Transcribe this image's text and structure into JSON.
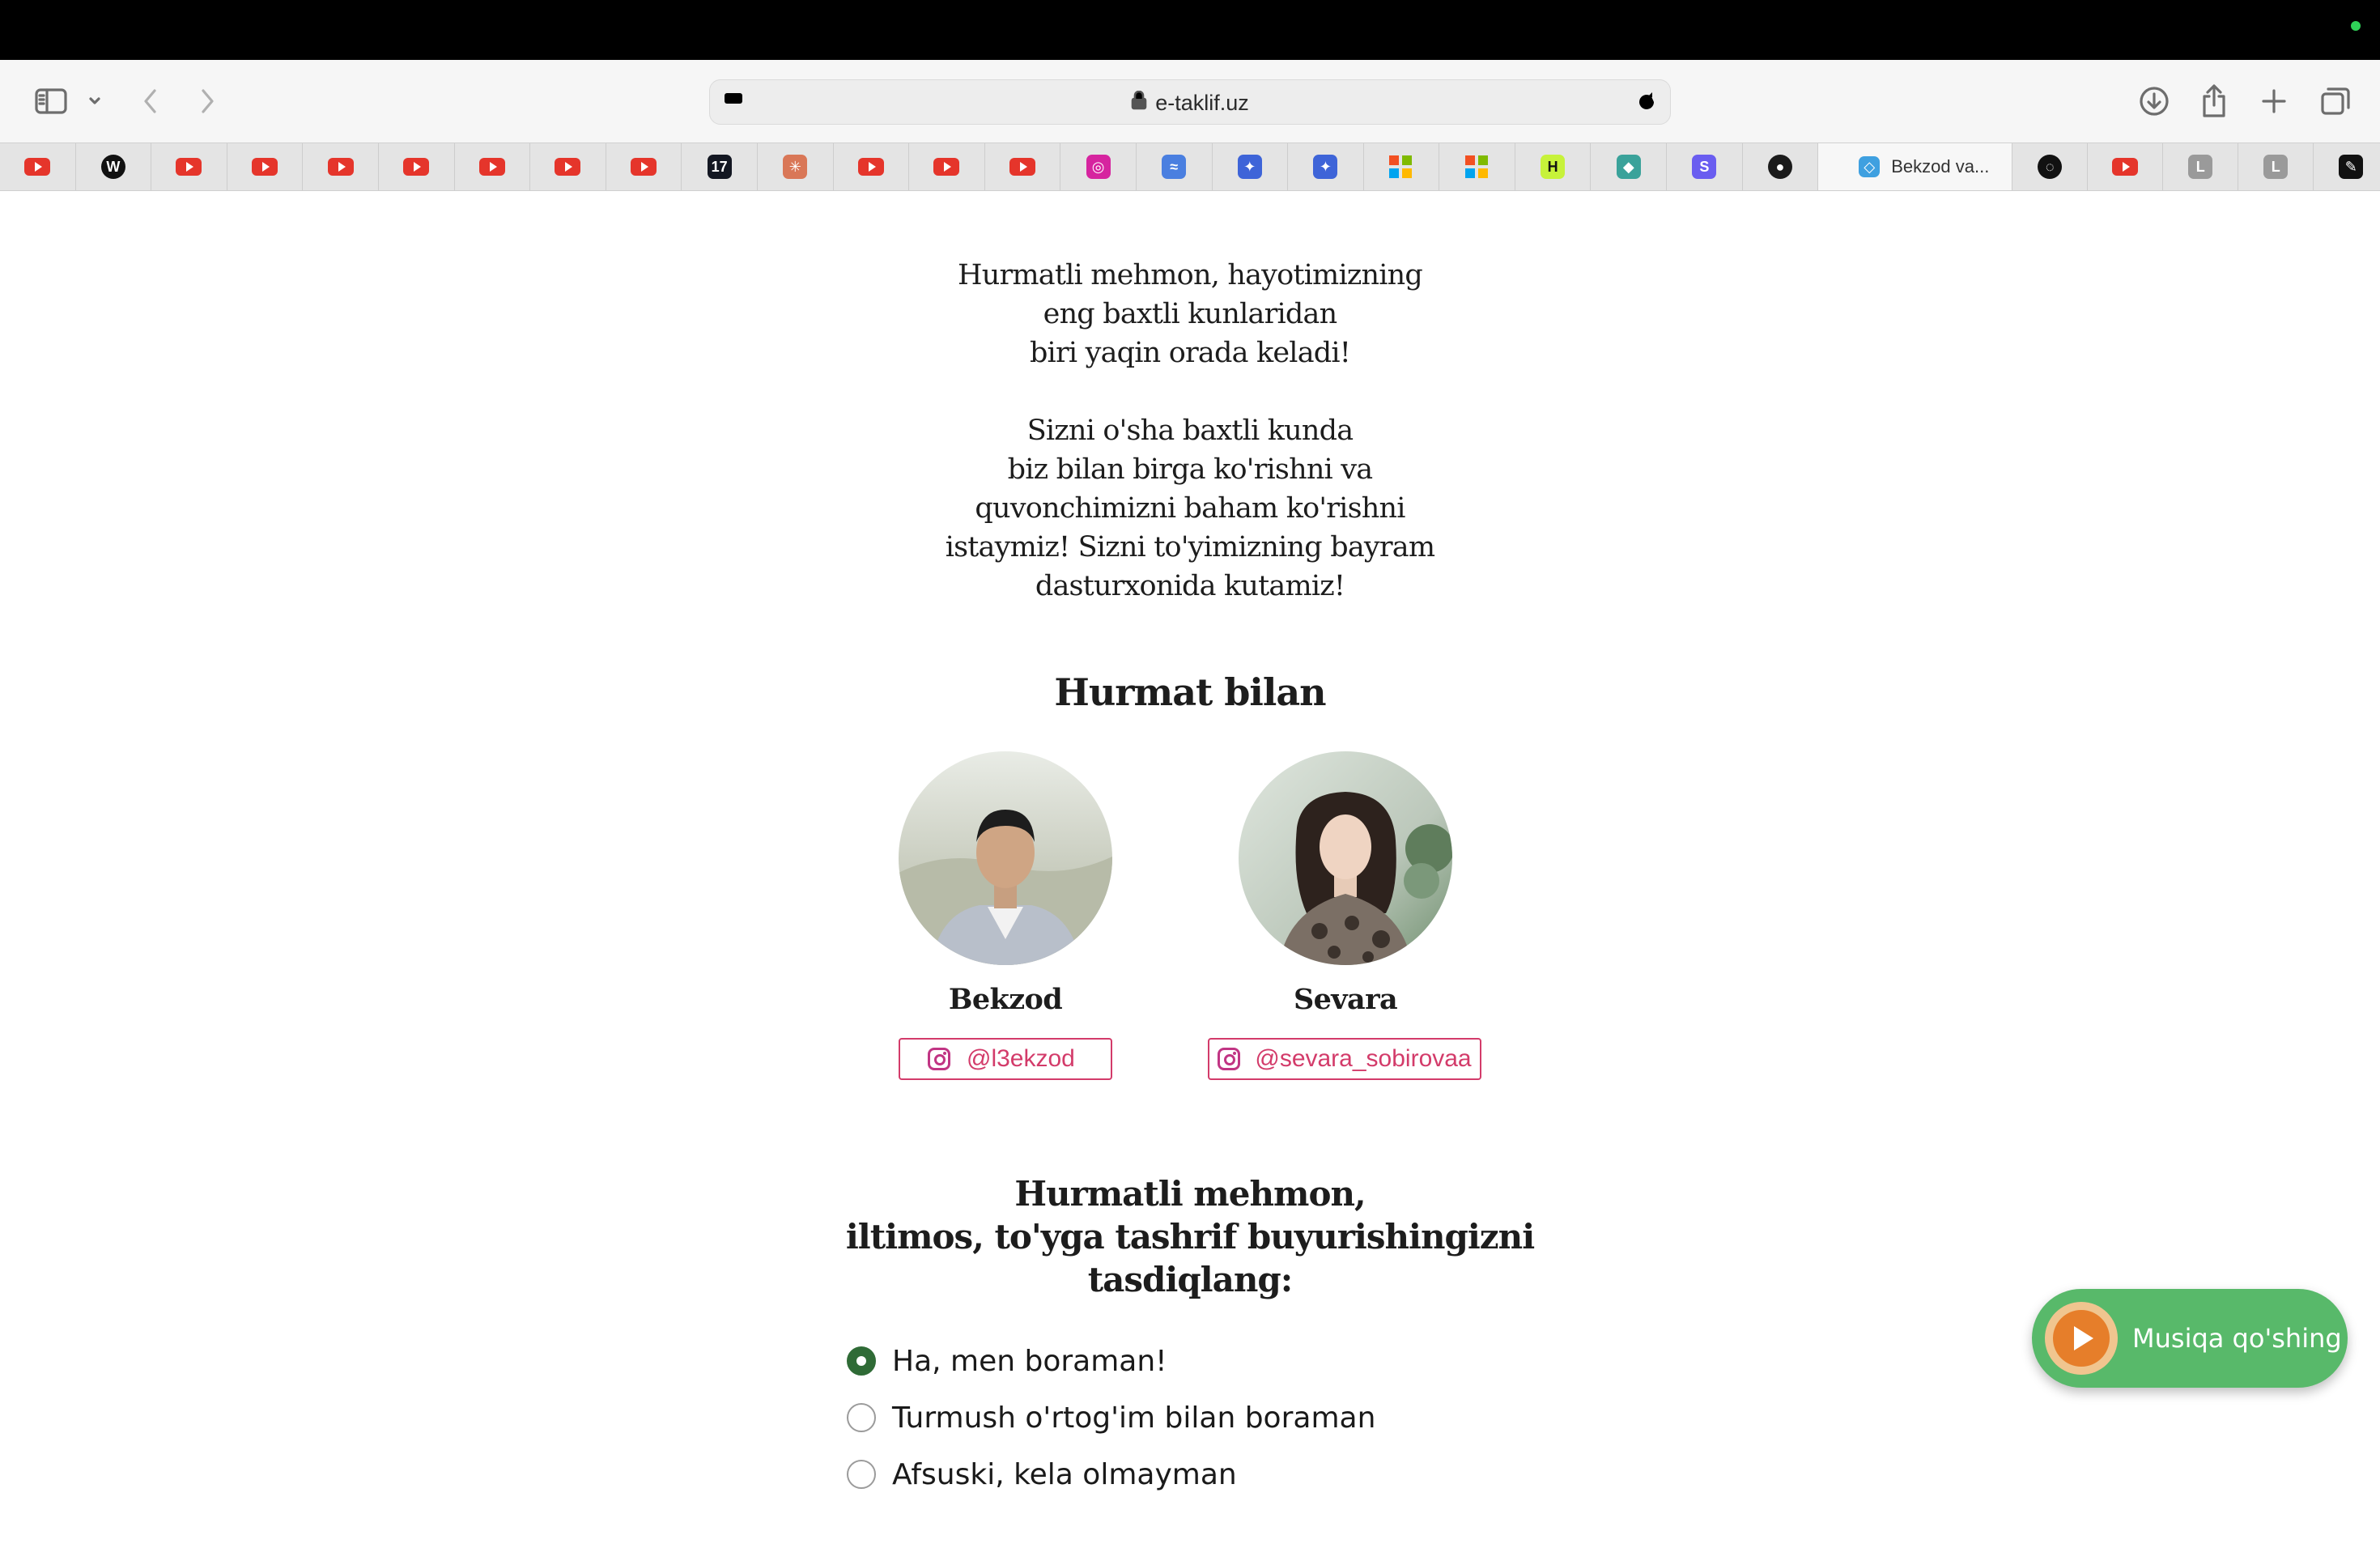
{
  "browser": {
    "address": "e-taklif.uz",
    "active_tab_label": "Bekzod va...",
    "favorites": [
      {
        "icon": "youtube-icon",
        "color": "#e5352b"
      },
      {
        "icon": "w-icon",
        "letter": "W",
        "color": "#111111"
      },
      {
        "icon": "youtube-icon",
        "color": "#e5352b"
      },
      {
        "icon": "youtube-icon",
        "color": "#e5352b"
      },
      {
        "icon": "youtube-icon",
        "color": "#e5352b"
      },
      {
        "icon": "youtube-icon",
        "color": "#e5352b"
      },
      {
        "icon": "youtube-icon",
        "color": "#e5352b"
      },
      {
        "icon": "youtube-icon",
        "color": "#e5352b"
      },
      {
        "icon": "youtube-icon",
        "color": "#e5352b"
      },
      {
        "icon": "tradingview-icon",
        "letter": "17",
        "color": "#131722"
      },
      {
        "icon": "claude-icon",
        "letter": "✳",
        "color": "#d97757"
      },
      {
        "icon": "youtube-icon",
        "color": "#e5352b"
      },
      {
        "icon": "youtube-icon",
        "color": "#e5352b"
      },
      {
        "icon": "youtube-icon",
        "color": "#e5352b"
      },
      {
        "icon": "instagram-icon",
        "letter": "◎",
        "color": "#d6249f"
      },
      {
        "icon": "wing-icon",
        "letter": "≈",
        "color": "#4a7fe0"
      },
      {
        "icon": "bird-icon",
        "letter": "✦",
        "color": "#3e64d8"
      },
      {
        "icon": "bird-icon",
        "letter": "✦",
        "color": "#3e64d8"
      },
      {
        "icon": "microsoft-icon",
        "letter": "",
        "color": "#f25022"
      },
      {
        "icon": "microsoft-icon",
        "letter": "",
        "color": "#f25022"
      },
      {
        "icon": "hashnode-icon",
        "letter": "H",
        "color": "#c7f23a"
      },
      {
        "icon": "diamond-icon",
        "letter": "◆",
        "color": "#3aa29a"
      },
      {
        "icon": "s-icon",
        "letter": "S",
        "color": "#6a5df0"
      },
      {
        "icon": "github-icon",
        "letter": "●",
        "color": "#1b1b1b"
      }
    ],
    "tail_tabs": [
      {
        "icon": "circle-icon",
        "letter": "◌",
        "color": "#111111"
      },
      {
        "icon": "youtube-icon",
        "color": "#e5352b"
      },
      {
        "icon": "l-icon",
        "letter": "L",
        "color": "#9a9a9a"
      },
      {
        "icon": "l-icon",
        "letter": "L",
        "color": "#9a9a9a"
      },
      {
        "icon": "pen-icon",
        "letter": "✎",
        "color": "#111111"
      }
    ]
  },
  "invitation": {
    "intro_lines_1": [
      "Hurmatli mehmon, hayotimizning",
      "eng baxtli kunlaridan",
      "biri yaqin orada keladi!"
    ],
    "intro_lines_2": [
      "Sizni o'sha baxtli kunda",
      "biz bilan birga ko'rishni va",
      "quvonchimizni baham ko'rishni",
      "istaymiz! Sizni to'yimizning bayram",
      "dasturxonida kutamiz!"
    ],
    "regards": "Hurmat bilan",
    "hosts": [
      {
        "name": "Bekzod",
        "instagram": "@l3ekzod"
      },
      {
        "name": "Sevara",
        "instagram": "@sevara_sobirovaa"
      }
    ]
  },
  "rsvp": {
    "question_lines": [
      "Hurmatli mehmon,",
      "iltimos, to'yga tashrif buyurishingizni",
      "tasdiqlang:"
    ],
    "options": [
      {
        "label": "Ha, men boraman!",
        "selected": true
      },
      {
        "label": "Turmush o'rtog'im bilan boraman",
        "selected": false
      },
      {
        "label": "Afsuski, kela olmayman",
        "selected": false
      }
    ]
  },
  "music_button": {
    "label": "Musiqa qo'shing",
    "color": "#58b96a"
  }
}
